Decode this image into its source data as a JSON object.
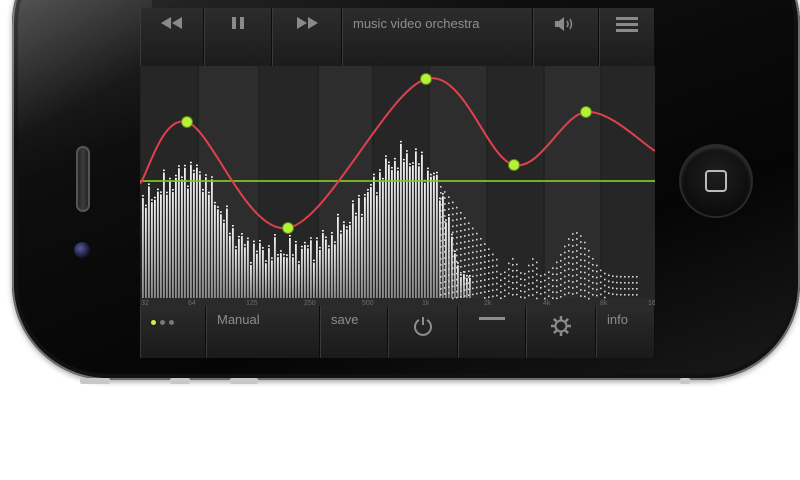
{
  "app": {
    "title": "music video orchestra",
    "accent_color": "#a6e22e",
    "curve_color": "#e0404e"
  },
  "topbar": {
    "rewind_icon": "rewind-icon",
    "pause_icon": "pause-icon",
    "fast_forward_icon": "fast-forward-icon",
    "volume_icon": "volume-icon",
    "menu_icon": "menu-icon"
  },
  "eq": {
    "freq_labels": [
      "32",
      "64",
      "125",
      "250",
      "500",
      "1k",
      "2k",
      "4k",
      "8k",
      "16k"
    ]
  },
  "bottombar": {
    "page_dots": 3,
    "active_dot": 0,
    "preset_label": "Manual",
    "save_label": "save",
    "power_icon": "power-icon",
    "flat_icon": "flat-line-icon",
    "settings_icon": "gear-icon",
    "info_label": "info"
  }
}
